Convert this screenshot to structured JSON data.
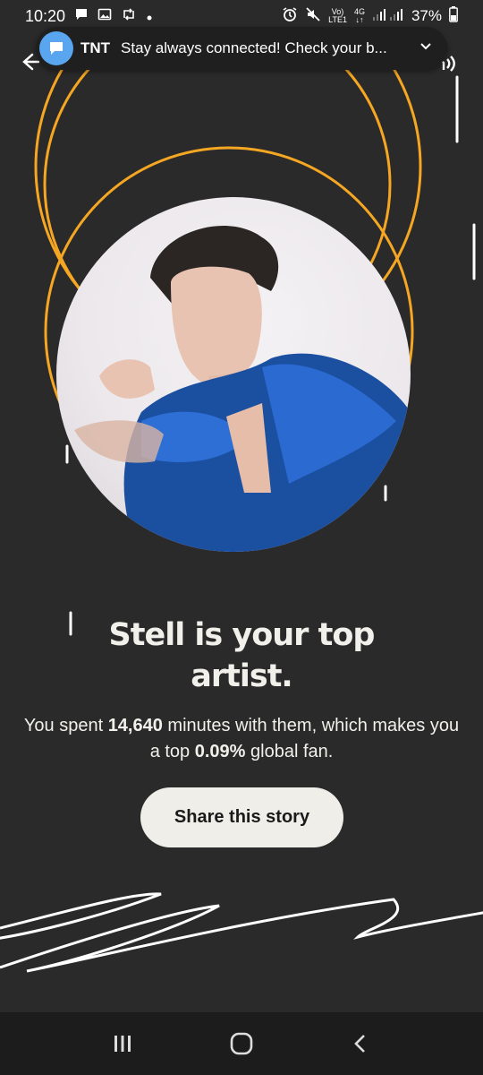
{
  "status_bar": {
    "time": "10:20",
    "signal_top": "Vo)",
    "signal_bottom": "LTE1",
    "net_top": "4G",
    "net_bottom": "↓↑",
    "battery": "37%"
  },
  "notification": {
    "app": "TNT",
    "text": "Stay always connected! Check your b..."
  },
  "story": {
    "headline_line1": "Stell is your top",
    "headline_line2": "artist.",
    "body_pre": "You spent ",
    "minutes": "14,640",
    "body_mid": " minutes with them, which makes you a top ",
    "percent": "0.09%",
    "body_post": " global fan.",
    "share_label": "Share this story"
  },
  "colors": {
    "background": "#2a2a2a",
    "accent_orange": "#f5a623",
    "button_bg": "#efeee8",
    "notif_icon": "#5aa5f0"
  },
  "icons": [
    "message-icon",
    "gallery-icon",
    "retweet-icon",
    "alarm-icon",
    "mute-icon",
    "wifi-signal-icon",
    "battery-icon",
    "back-arrow-icon",
    "audio-icon",
    "chevron-down-icon",
    "recent-apps-icon",
    "home-icon",
    "back-icon"
  ]
}
